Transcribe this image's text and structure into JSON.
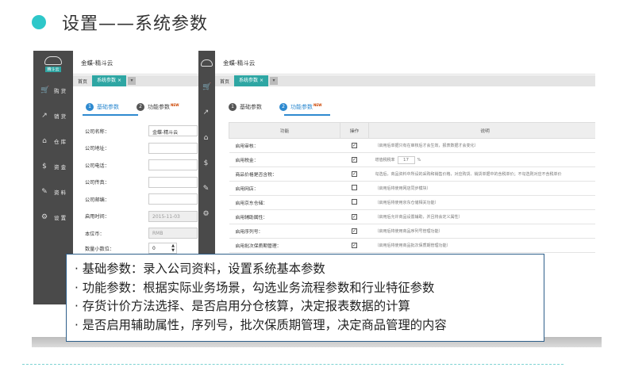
{
  "slide": {
    "title": "设置——系统参数",
    "accent_color": "#2ec7c9",
    "callout_color": "#2e5f8a"
  },
  "app": {
    "title": "金蝶-精斗云",
    "logo_tag": "精斗云",
    "sidebar": [
      {
        "icon": "cart-icon",
        "glyph": "🛒",
        "label": "购 货"
      },
      {
        "icon": "sale-icon",
        "glyph": "↗",
        "label": "销 货"
      },
      {
        "icon": "warehouse-icon",
        "glyph": "⌂",
        "label": "仓 库"
      },
      {
        "icon": "money-icon",
        "glyph": "$",
        "label": "资 金"
      },
      {
        "icon": "pencil-icon",
        "glyph": "✎",
        "label": "资 料"
      },
      {
        "icon": "gear-icon",
        "glyph": "⚙",
        "label": "设 置"
      }
    ],
    "tabs": {
      "home": "首页",
      "active": "系统参数",
      "close": "×",
      "more": "▾"
    }
  },
  "steps": [
    {
      "num": "1",
      "label": "基础参数"
    },
    {
      "num": "2",
      "label": "功能参数",
      "badge": "NEW"
    }
  ],
  "basic_form": [
    {
      "label": "公司名称：",
      "value": "金蝶-精斗云",
      "disabled": false
    },
    {
      "label": "公司地址：",
      "value": "",
      "disabled": false
    },
    {
      "label": "公司电话：",
      "value": "",
      "disabled": false
    },
    {
      "label": "公司传真：",
      "value": "",
      "disabled": false
    },
    {
      "label": "公司邮编：",
      "value": "",
      "disabled": false
    },
    {
      "label": "启用时间：",
      "value": "2015-11-03",
      "disabled": true
    },
    {
      "label": "本位币：",
      "value": "RMB",
      "disabled": true
    }
  ],
  "qty_decimals": {
    "label": "数量小数位：",
    "value": "0"
  },
  "function_table": {
    "headers": [
      "功能",
      "操作",
      "说明"
    ],
    "rows": [
      {
        "name": "启用审核：",
        "checked": true,
        "desc": "（启用后单据只有在审核后才会生效，报表数据才会变化）"
      },
      {
        "name": "启用税金：",
        "checked": true,
        "desc_prefix": "增值税税率",
        "tax": "17",
        "unit": "%"
      },
      {
        "name": "商品价格是否含税：",
        "checked": true,
        "desc": "勾选后，商品资料中所设的采购和销售价格，对应购货、销货单据中的含税单价；不勾选则对应不含税单价"
      },
      {
        "name": "启用网店：",
        "checked": false,
        "desc": "（启用后将使用网店同步模块）"
      },
      {
        "name": "启用京东仓储：",
        "checked": false,
        "desc": "（启用后将使用京东仓储相关功能）"
      },
      {
        "name": "启用辅助属性：",
        "checked": true,
        "desc": "（启用后允许商品设置辅助，并且将会定义属性）"
      },
      {
        "name": "启用序列号：",
        "checked": true,
        "desc": "（启用后将使用商品序列号管理功能）"
      },
      {
        "name": "启用批次保质期管理：",
        "checked": true,
        "desc": "（启用后将使用商品批次保质期管理功能）"
      }
    ]
  },
  "callout": [
    "· 基础参数：录入公司资料，设置系统基本参数",
    "· 功能参数：根据实际业务场景，勾选业务流程参数和行业特征参数",
    "· 存货计价方法选择、是否启用分仓核算，决定报表数据的计算",
    "· 是否启用辅助属性，序列号，批次保质期管理，决定商品管理的内容"
  ]
}
